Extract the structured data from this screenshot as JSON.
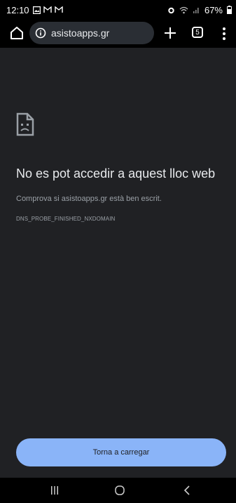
{
  "status_bar": {
    "time": "12:10",
    "battery_percent": "67%",
    "left_icons": [
      "image-notification-icon",
      "gmail-icon",
      "gmail-icon"
    ],
    "right_icons": [
      "alarm-icon",
      "wifi-icon",
      "signal-icon",
      "battery-icon"
    ]
  },
  "toolbar": {
    "url": "asistoapps.gr",
    "tab_count": "5"
  },
  "error_page": {
    "heading": "No es pot accedir a aquest lloc web",
    "description": "Comprova si asistoapps.gr està ben escrit.",
    "error_code": "DNS_PROBE_FINISHED_NXDOMAIN",
    "reload_button": "Torna a carregar"
  },
  "colors": {
    "page_bg": "#202124",
    "bar_bg": "#000000",
    "accent": "#8ab4f8"
  }
}
